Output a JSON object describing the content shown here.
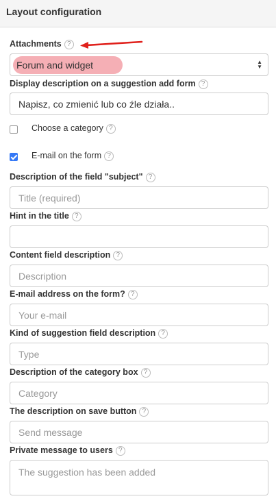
{
  "header": {
    "title": "Layout configuration"
  },
  "attachments": {
    "label": "Attachments",
    "help": "?",
    "selected_value": "Forum and widget",
    "annotation_color": "#e0211c",
    "highlight_color": "#f3a1a8"
  },
  "display_description": {
    "label": "Display description on a suggestion add form",
    "help": "?",
    "value": "Napisz, co zmienić lub co źle działa.."
  },
  "choose_category": {
    "label": "Choose a category",
    "help": "?",
    "checked": false
  },
  "email_on_form": {
    "label": "E-mail on the form",
    "help": "?",
    "checked": true
  },
  "subject_field": {
    "label": "Description of the field \"subject\"",
    "help": "?",
    "placeholder": "Title (required)"
  },
  "hint_in_title": {
    "label": "Hint in the title",
    "help": "?",
    "value": ""
  },
  "content_field": {
    "label": "Content field description",
    "help": "?",
    "placeholder": "Description"
  },
  "email_address": {
    "label": "E-mail address on the form?",
    "help": "?",
    "placeholder": "Your e-mail"
  },
  "kind_field": {
    "label": "Kind of suggestion field description",
    "help": "?",
    "placeholder": "Type"
  },
  "category_box": {
    "label": "Description of the category box",
    "help": "?",
    "placeholder": "Category"
  },
  "save_button_desc": {
    "label": "The description on save button",
    "help": "?",
    "placeholder": "Send message"
  },
  "private_message": {
    "label": "Private message to users",
    "help": "?",
    "placeholder": "The suggestion has been added"
  }
}
